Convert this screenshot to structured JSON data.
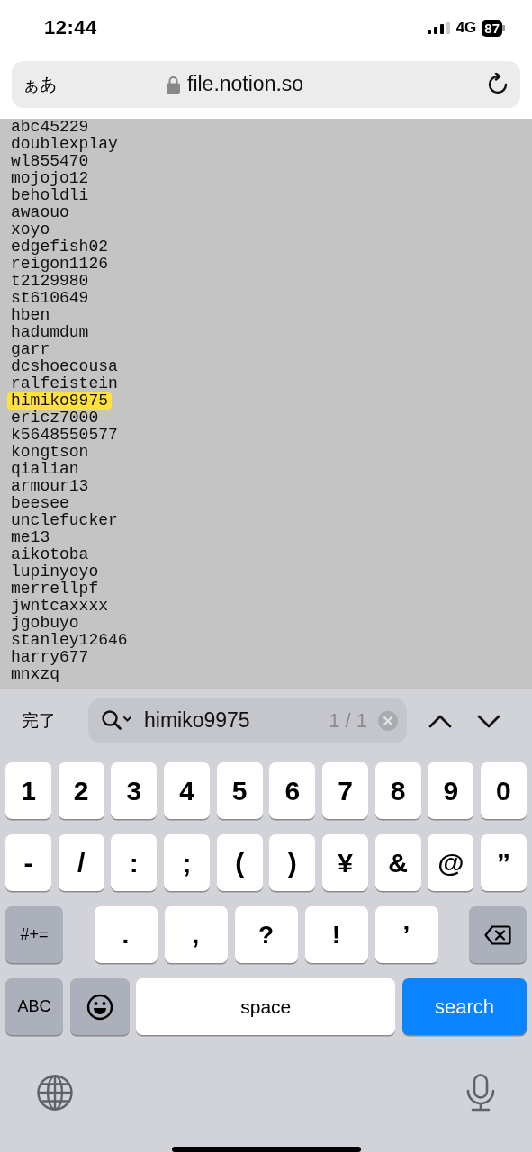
{
  "status_bar": {
    "time": "12:44",
    "network": "4G",
    "battery": "87"
  },
  "address_bar": {
    "text_size": "ぁあ",
    "url": "file.notion.so"
  },
  "page": {
    "lines": [
      {
        "text": "abc45229",
        "highlighted": false
      },
      {
        "text": "doublexplay",
        "highlighted": false
      },
      {
        "text": "wl855470",
        "highlighted": false
      },
      {
        "text": "mojojo12",
        "highlighted": false
      },
      {
        "text": "beholdli",
        "highlighted": false
      },
      {
        "text": "awaouo",
        "highlighted": false
      },
      {
        "text": "xoyo",
        "highlighted": false
      },
      {
        "text": "edgefish02",
        "highlighted": false
      },
      {
        "text": "reigon1126",
        "highlighted": false
      },
      {
        "text": "t2129980",
        "highlighted": false
      },
      {
        "text": "st610649",
        "highlighted": false
      },
      {
        "text": "hben",
        "highlighted": false
      },
      {
        "text": "hadumdum",
        "highlighted": false
      },
      {
        "text": "garr",
        "highlighted": false
      },
      {
        "text": "dcshoecousa",
        "highlighted": false
      },
      {
        "text": "ralfeistein",
        "highlighted": false
      },
      {
        "text": "himiko9975",
        "highlighted": true
      },
      {
        "text": "ericz7000",
        "highlighted": false
      },
      {
        "text": "k5648550577",
        "highlighted": false
      },
      {
        "text": "kongtson",
        "highlighted": false
      },
      {
        "text": "qialian",
        "highlighted": false
      },
      {
        "text": "armour13",
        "highlighted": false
      },
      {
        "text": "beesee",
        "highlighted": false
      },
      {
        "text": "unclefucker",
        "highlighted": false
      },
      {
        "text": "me13",
        "highlighted": false
      },
      {
        "text": "aikotoba",
        "highlighted": false
      },
      {
        "text": "lupinyoyo",
        "highlighted": false
      },
      {
        "text": "merrellpf",
        "highlighted": false
      },
      {
        "text": "jwntcaxxxx",
        "highlighted": false
      },
      {
        "text": "jgobuyo",
        "highlighted": false
      },
      {
        "text": "stanley12646",
        "highlighted": false
      },
      {
        "text": "harry677",
        "highlighted": false
      },
      {
        "text": "mnxzq",
        "highlighted": false
      }
    ]
  },
  "find_bar": {
    "done": "完了",
    "query": "himiko9975",
    "count": "1 / 1"
  },
  "keyboard": {
    "rows": [
      {
        "keys": [
          {
            "label": "1",
            "kind": "char"
          },
          {
            "label": "2",
            "kind": "char"
          },
          {
            "label": "3",
            "kind": "char"
          },
          {
            "label": "4",
            "kind": "char"
          },
          {
            "label": "5",
            "kind": "char"
          },
          {
            "label": "6",
            "kind": "char"
          },
          {
            "label": "7",
            "kind": "char"
          },
          {
            "label": "8",
            "kind": "char"
          },
          {
            "label": "9",
            "kind": "char"
          },
          {
            "label": "0",
            "kind": "char"
          }
        ]
      },
      {
        "keys": [
          {
            "label": "-",
            "kind": "char"
          },
          {
            "label": "/",
            "kind": "char"
          },
          {
            "label": ":",
            "kind": "char"
          },
          {
            "label": ";",
            "kind": "char"
          },
          {
            "label": "(",
            "kind": "char"
          },
          {
            "label": ")",
            "kind": "char"
          },
          {
            "label": "¥",
            "kind": "char"
          },
          {
            "label": "&",
            "kind": "char"
          },
          {
            "label": "@",
            "kind": "char"
          },
          {
            "label": "”",
            "kind": "char"
          }
        ]
      },
      {
        "keys": [
          {
            "label": "#+=",
            "kind": "modifier"
          },
          {
            "label": ".",
            "kind": "wide"
          },
          {
            "label": ",",
            "kind": "wide"
          },
          {
            "label": "?",
            "kind": "wide"
          },
          {
            "label": "!",
            "kind": "wide"
          },
          {
            "label": "’",
            "kind": "wide"
          },
          {
            "kind": "delete"
          }
        ]
      },
      {
        "keys": [
          {
            "label": "ABC",
            "kind": "modifier"
          },
          {
            "kind": "emoji"
          },
          {
            "label": "space",
            "kind": "space"
          },
          {
            "label": "search",
            "kind": "action"
          }
        ]
      }
    ]
  }
}
